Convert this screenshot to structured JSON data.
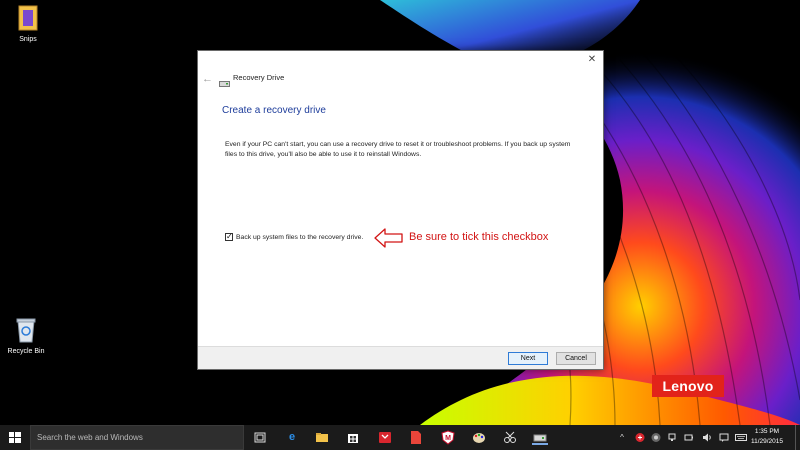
{
  "desktop": {
    "icons": [
      {
        "label": "Snips"
      },
      {
        "label": "Recycle Bin"
      }
    ],
    "brand_badge": "Lenovo",
    "brand_color": "#e2231a"
  },
  "dialog": {
    "nav_title": "Recovery Drive",
    "heading": "Create a recovery drive",
    "description": "Even if your PC can't start, you can use a recovery drive to reset it or troubleshoot problems. If you back up system files to this drive, you'll also be able to use it to reinstall Windows.",
    "checkbox": {
      "label": "Back up system files to the recovery drive.",
      "checked": true
    },
    "buttons": {
      "next": "Next",
      "cancel": "Cancel"
    },
    "heading_color": "#1e3d9b"
  },
  "annotation": {
    "text": "Be sure to tick this checkbox",
    "color": "#d21414"
  },
  "taskbar": {
    "search_placeholder": "Search the web and Windows",
    "pinned_icons": [
      "task-view-icon",
      "edge-icon",
      "file-explorer-icon",
      "store-icon",
      "app-red-icon",
      "pdf-icon",
      "mcafee-icon",
      "paint-icon",
      "snipping-tool-icon",
      "recovery-drive-icon"
    ],
    "clock": {
      "time": "1:35 PM",
      "date": "11/29/2015"
    }
  }
}
